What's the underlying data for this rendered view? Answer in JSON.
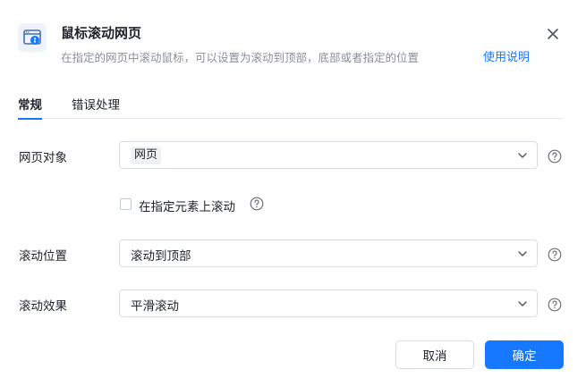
{
  "dialog": {
    "title": "鼠标滚动网页",
    "subtitle": "在指定的网页中滚动鼠标，可以设置为滚动到顶部，底部或者指定的位置",
    "help_link": "使用说明",
    "header_icon": "browser-scroll-icon",
    "close_icon": "close-icon"
  },
  "tabs": [
    {
      "label": "常规",
      "active": true
    },
    {
      "label": "错误处理",
      "active": false
    }
  ],
  "fields": {
    "web_object": {
      "label": "网页对象",
      "value": "网页"
    },
    "scroll_on_element": {
      "label": "在指定元素上滚动",
      "checked": false
    },
    "scroll_position": {
      "label": "滚动位置",
      "value": "滚动到顶部"
    },
    "scroll_effect": {
      "label": "滚动效果",
      "value": "平滑滚动"
    }
  },
  "buttons": {
    "cancel": "取消",
    "ok": "确定"
  },
  "colors": {
    "primary": "#1677ff",
    "border": "#d9dde3",
    "muted_text": "#8a8f99"
  }
}
